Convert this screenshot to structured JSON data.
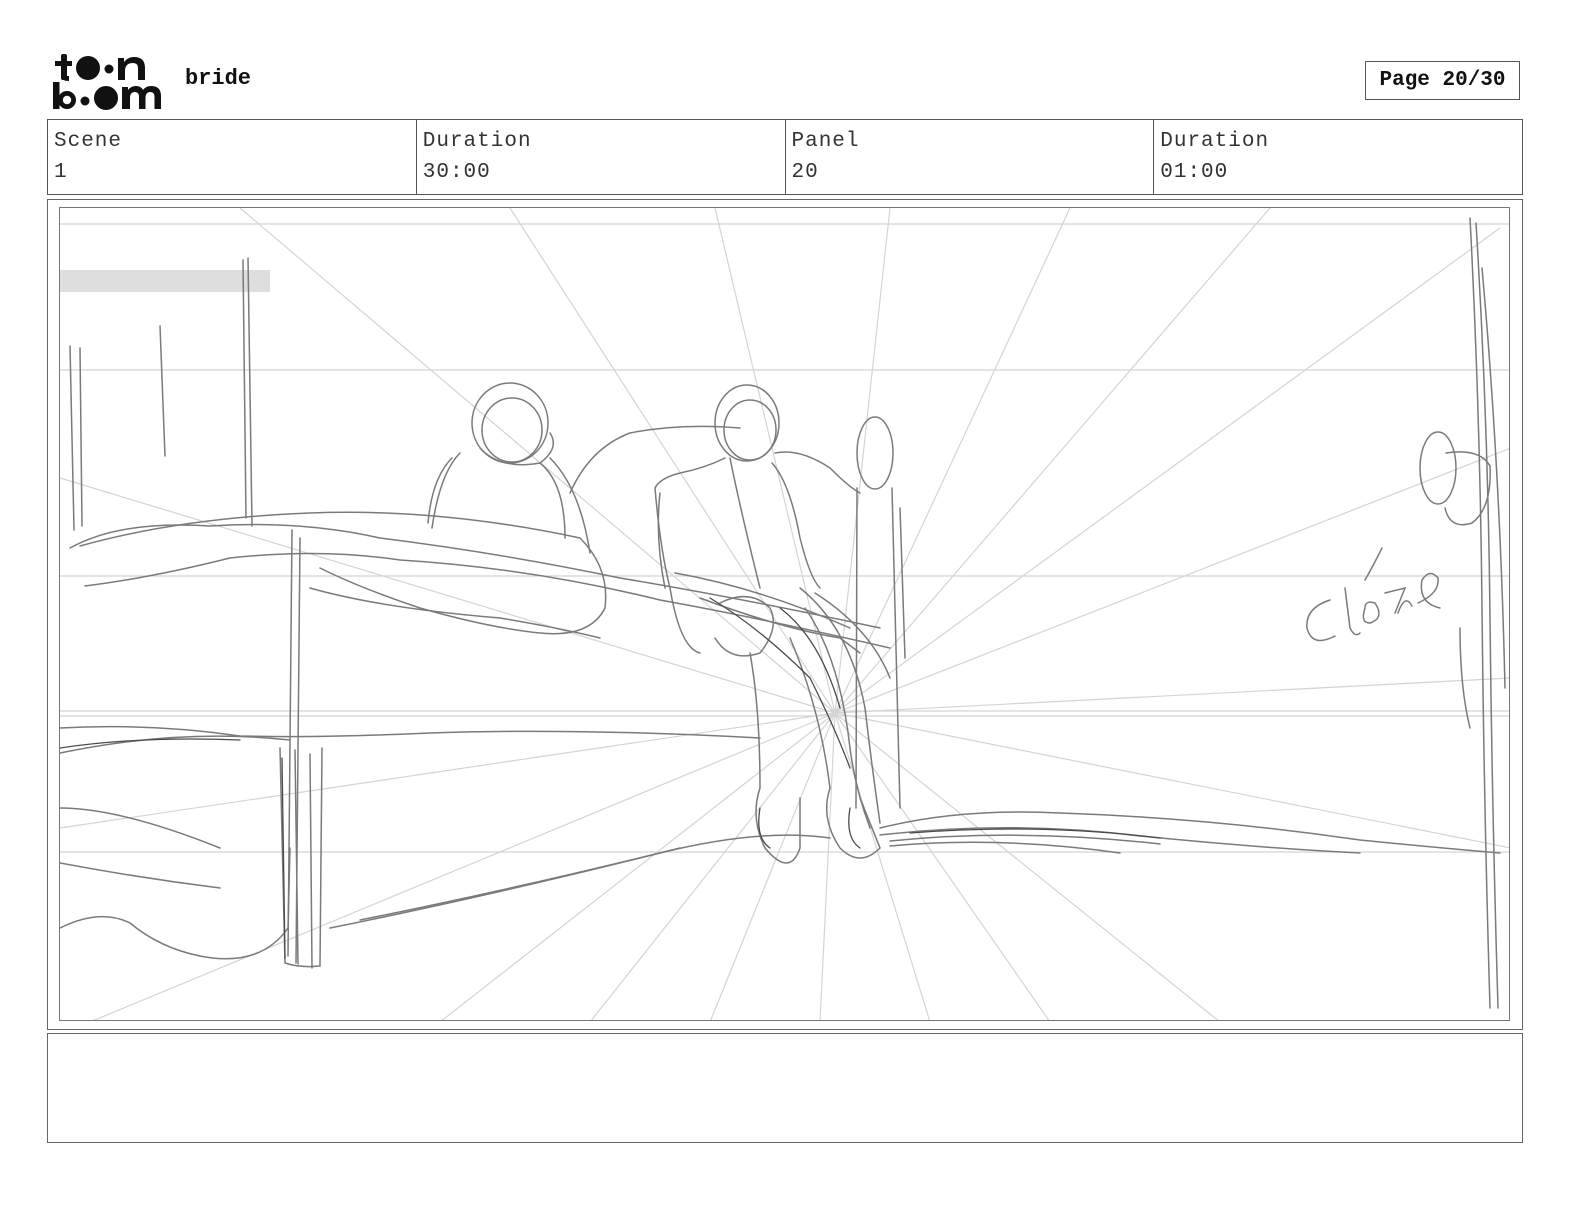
{
  "header": {
    "logo": {
      "text": "toon boom",
      "icon": "toon-boom-logo"
    },
    "project_name": "bride",
    "page_label": "Page 20/30"
  },
  "info_row": {
    "scene_label": "Scene",
    "scene_value": "1",
    "scene_duration_label": "Duration",
    "scene_duration_value": "30:00",
    "panel_label": "Panel",
    "panel_value": "20",
    "panel_duration_label": "Duration",
    "panel_duration_value": "01:00"
  },
  "panel": {
    "sketch_note": "close"
  },
  "notes": {
    "text": ""
  }
}
